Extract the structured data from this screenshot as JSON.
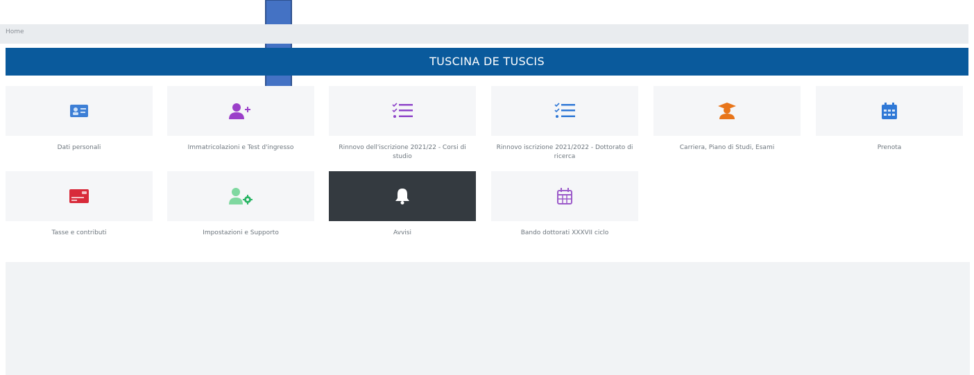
{
  "breadcrumb": {
    "label": "Home"
  },
  "header": {
    "title": "TUSCINA DE TUSCIS"
  },
  "tiles": [
    {
      "label": "Dati personali",
      "icon": "id-card-icon",
      "color": "#3d7fd6"
    },
    {
      "label": "Immatricolazioni e Test d'ingresso",
      "icon": "user-plus-icon",
      "color": "#9b3fc9"
    },
    {
      "label": "Rinnovo dell'iscrizione 2021/22 - Corsi di studio",
      "icon": "checklist-icon",
      "color": "#8e44c9"
    },
    {
      "label": "Rinnovo iscrizione 2021/2022 - Dottorato di ricerca",
      "icon": "checklist-icon",
      "color": "#2f78d6"
    },
    {
      "label": "Carriera, Piano di Studi, Esami",
      "icon": "graduate-icon",
      "color": "#e8751a"
    },
    {
      "label": "Prenota",
      "icon": "calendar-icon",
      "color": "#2f78d6"
    },
    {
      "label": "Tasse e contributi",
      "icon": "credit-card-icon",
      "color": "#d82a3a"
    },
    {
      "label": "Impostazioni e Supporto",
      "icon": "user-settings-icon",
      "color": "#28b463"
    },
    {
      "label": "Avvisi",
      "icon": "bell-icon",
      "color": "#ffffff"
    },
    {
      "label": "Bando dottorati XXXVII ciclo",
      "icon": "calendar-grid-icon",
      "color": "#9b59c9"
    }
  ],
  "annotation": {
    "icon": "down-arrow-icon",
    "color": "#4472c4"
  }
}
